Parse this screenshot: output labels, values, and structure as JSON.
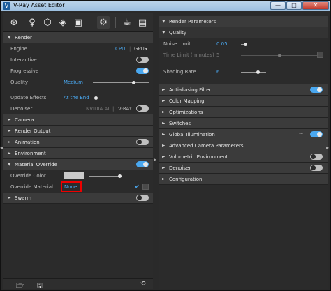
{
  "window": {
    "title": "V-Ray Asset Editor",
    "btn_min": "—",
    "btn_max": "□",
    "btn_close": "✕"
  },
  "toolbar": {
    "icons": [
      "materials-icon",
      "lights-icon",
      "geometry-icon",
      "textures-icon",
      "render-elements-icon",
      "settings-icon",
      "render-teapot-icon",
      "frame-buffer-icon"
    ]
  },
  "left": {
    "render": {
      "header": "Render",
      "engine_label": "Engine",
      "engine_cpu": "CPU",
      "engine_gpu": "GPU",
      "interactive_label": "Interactive",
      "interactive_on": false,
      "progressive_label": "Progressive",
      "progressive_on": true,
      "quality_label": "Quality",
      "quality_value": "Medium",
      "quality_level": 0.72,
      "update_effects_label": "Update Effects",
      "update_effects_value": "At the End",
      "denoiser_label": "Denoiser",
      "denoiser_nvidia": "NVIDIA AI",
      "denoiser_vray": "V-RAY",
      "denoiser_on": false
    },
    "sections": {
      "camera": "Camera",
      "render_output": "Render Output",
      "animation": "Animation",
      "environment": "Environment",
      "material_override": "Material Override",
      "swarm": "Swarm"
    },
    "material_override": {
      "on": true,
      "color_label": "Override Color",
      "material_label": "Override Material",
      "material_value": "None"
    }
  },
  "right": {
    "header": "Render Parameters",
    "quality": {
      "header": "Quality",
      "noise_limit_label": "Noise Limit",
      "noise_limit_value": "0.05",
      "time_limit_label": "Time Limit (minutes)",
      "time_limit_value": "5",
      "shading_rate_label": "Shading Rate",
      "shading_rate_value": "6"
    },
    "sections": {
      "antialiasing": "Antialiasing Filter",
      "color_mapping": "Color Mapping",
      "optimizations": "Optimizations",
      "switches": "Switches",
      "global_illumination": "Global Illumination",
      "advanced_camera": "Advanced Camera Parameters",
      "volumetric_env": "Volumetric Environment",
      "denoiser": "Denoiser",
      "configuration": "Configuration"
    }
  },
  "colors": {
    "accent": "#4aa8f0",
    "panel": "#2b2b2b",
    "header": "#3b3b3b",
    "highlight": "#e00000"
  }
}
